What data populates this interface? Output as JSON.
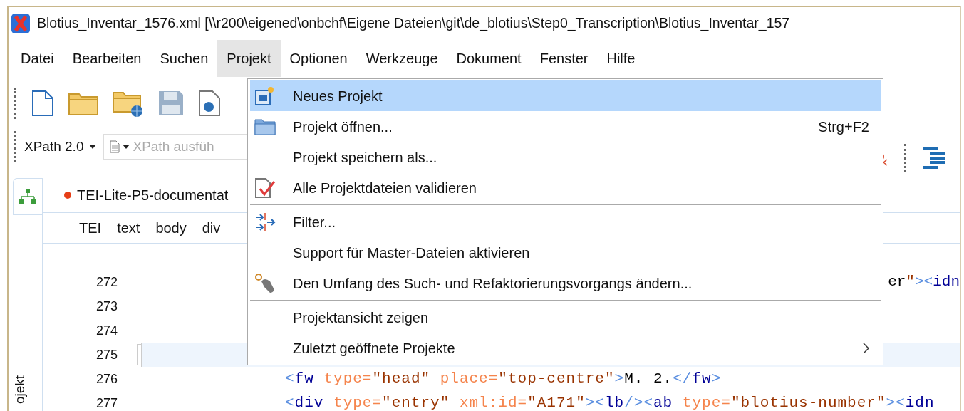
{
  "window": {
    "title": "Blotius_Inventar_1576.xml [\\\\r200\\eigened\\onbchf\\Eigene Dateien\\git\\de_blotius\\Step0_Transcription\\Blotius_Inventar_157"
  },
  "menubar": [
    {
      "label": "Datei",
      "selected": false
    },
    {
      "label": "Bearbeiten",
      "selected": false
    },
    {
      "label": "Suchen",
      "selected": false
    },
    {
      "label": "Projekt",
      "selected": true
    },
    {
      "label": "Optionen",
      "selected": false
    },
    {
      "label": "Werkzeuge",
      "selected": false
    },
    {
      "label": "Dokument",
      "selected": false
    },
    {
      "label": "Fenster",
      "selected": false
    },
    {
      "label": "Hilfe",
      "selected": false
    }
  ],
  "xpath_bar": {
    "version": "XPath 2.0",
    "placeholder": "XPath ausfüh"
  },
  "side_panel": {
    "label": "ojekt"
  },
  "editor": {
    "tab": {
      "label": "TEI-Lite-P5-documentat",
      "modified": true
    },
    "breadcrumb": [
      "TEI",
      "text",
      "body",
      "div"
    ],
    "lines": [
      {
        "number": "272",
        "kind": "tail",
        "code": "er\"><idn",
        "current": false
      },
      {
        "number": "273",
        "kind": "full",
        "current": false
      },
      {
        "number": "274",
        "kind": "full",
        "current": false
      },
      {
        "number": "275",
        "kind": "full",
        "current": true
      },
      {
        "number": "276",
        "kind": "full",
        "code": "<fw type=\"head\" place=\"top-centre\">M. 2.</fw>",
        "current": false
      },
      {
        "number": "277",
        "kind": "full",
        "code": "<div type=\"entry\" xml:id=\"A171\"><lb/><ab type=\"blotius-number\"><idn",
        "current": false
      }
    ]
  },
  "dropdown_menu": [
    {
      "kind": "item",
      "label": "Neues Projekt",
      "selected": true
    },
    {
      "kind": "item",
      "label": "Projekt öffnen...",
      "shortcut": "Strg+F2",
      "selected": false
    },
    {
      "kind": "item",
      "label": "Projekt speichern als...",
      "selected": false
    },
    {
      "kind": "item",
      "label": "Alle Projektdateien validieren",
      "selected": false
    },
    {
      "kind": "separator"
    },
    {
      "kind": "item",
      "label": "Filter...",
      "selected": false
    },
    {
      "kind": "item",
      "label": "Support für Master-Dateien aktivieren",
      "selected": false
    },
    {
      "kind": "item",
      "label": "Den Umfang des Such- und Refaktorierungsvorgangs ändern...",
      "selected": false
    },
    {
      "kind": "separator"
    },
    {
      "kind": "item",
      "label": "Projektansicht zeigen",
      "selected": false
    },
    {
      "kind": "item",
      "label": "Zuletzt geöffnete Projekte",
      "submenu": true,
      "selected": false
    }
  ]
}
